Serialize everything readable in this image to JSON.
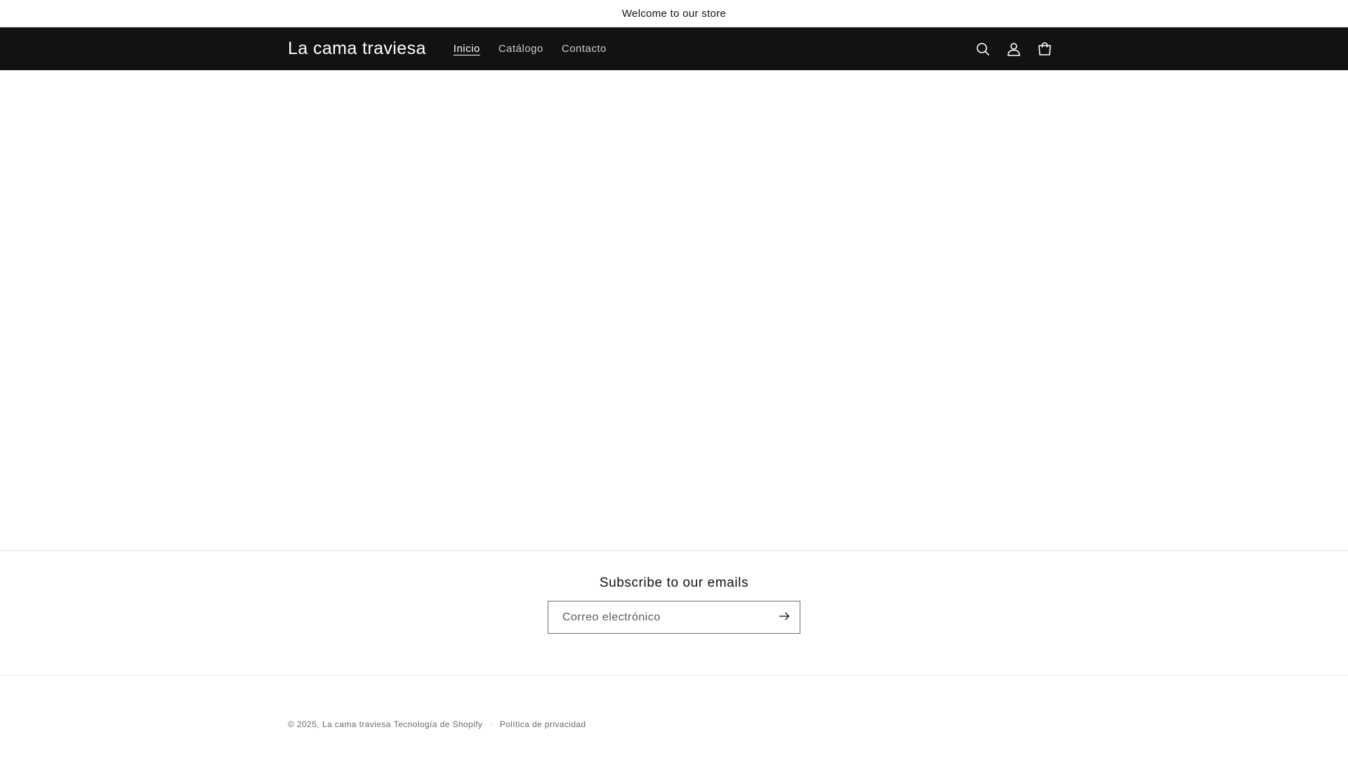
{
  "announcement": {
    "text": "Welcome to our store"
  },
  "header": {
    "logo": "La cama traviesa",
    "nav": [
      {
        "label": "Inicio",
        "active": true
      },
      {
        "label": "Catálogo",
        "active": false
      },
      {
        "label": "Contacto",
        "active": false
      }
    ],
    "icons": [
      "search-icon",
      "account-icon",
      "cart-icon"
    ]
  },
  "newsletter": {
    "title": "Subscribe to our emails",
    "email_placeholder": "Correo electrónico",
    "submit_icon": "arrow-right-icon"
  },
  "footer": {
    "copyright_prefix": "© 2025,",
    "store_name": "La cama traviesa",
    "powered_by": "Tecnología de Shopify",
    "separator": "·",
    "privacy_policy": "Política de privacidad"
  },
  "colors": {
    "header_bg": "#121212",
    "header_text": "#ffffff",
    "body_bg": "#ffffff",
    "text": "#121212",
    "border": "#e6e6e6"
  }
}
